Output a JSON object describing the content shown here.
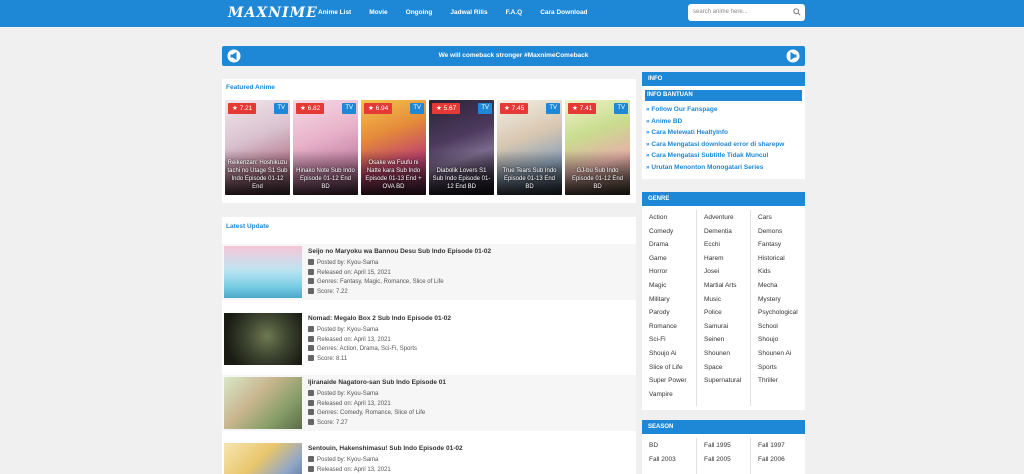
{
  "header": {
    "logo": "MAXNIME",
    "nav": [
      "Anime List",
      "Movie",
      "Ongoing",
      "Jadwal Rilis",
      "F.A.Q",
      "Cara Download"
    ],
    "search_placeholder": "search anime here..."
  },
  "banner": {
    "text": "We will comeback stronger #MaxnimeComeback"
  },
  "featured": {
    "title": "Featured Anime",
    "cards": [
      {
        "rating": "7.21",
        "type": "TV",
        "title": "Reikenzan: Hoshikuzu tachi no Utage S1 Sub Indo Episode 01-12 End"
      },
      {
        "rating": "6.82",
        "type": "TV",
        "title": "Hinako Note Sub Indo Episode 01-12 End BD"
      },
      {
        "rating": "6.94",
        "type": "TV",
        "title": "Osake wa Fuufu ni Natte kara Sub Indo Episode 01-13 End + OVA BD"
      },
      {
        "rating": "5.67",
        "type": "TV",
        "title": "Diabolik Lovers S1 Sub Indo Episode 01-12 End BD"
      },
      {
        "rating": "7.45",
        "type": "TV",
        "title": "True Tears Sub Indo Episode 01-13 End BD"
      },
      {
        "rating": "7.41",
        "type": "TV",
        "title": "GJ-bu Sub Indo Episode 01-12 End BD"
      }
    ]
  },
  "latest": {
    "title": "Latest Update",
    "items": [
      {
        "title": "Seijo no Maryoku wa Bannou Desu Sub Indo Episode 01-02",
        "posted": "Posted by: Kyou-Sama",
        "released": "Released on: April 15, 2021",
        "genres": "Genres: Fantasy, Magic, Romance, Slice of Life",
        "score": "Score: 7.22"
      },
      {
        "title": "Nomad: Megalo Box 2 Sub Indo Episode 01-02",
        "posted": "Posted by: Kyou-Sama",
        "released": "Released on: April 13, 2021",
        "genres": "Genres: Action, Drama, Sci-Fi, Sports",
        "score": "Score: 8.11"
      },
      {
        "title": "Ijiranaide Nagatoro-san Sub Indo Episode 01",
        "posted": "Posted by: Kyou-Sama",
        "released": "Released on: April 13, 2021",
        "genres": "Genres: Comedy, Romance, Slice of Life",
        "score": "Score: 7.27"
      },
      {
        "title": "Sentouin, Hakenshimasu! Sub Indo Episode 01-02",
        "posted": "Posted by: Kyou-Sama",
        "released": "Released on: April 13, 2021",
        "genres": "",
        "score": ""
      }
    ]
  },
  "info": {
    "head": "INFO",
    "sub": "INFO BANTUAN",
    "links": [
      "» Follow Our Fanspage",
      "» Anime BD",
      "» Cara Melewati HealtyInfo",
      "» Cara Mengatasi download error di sharepw",
      "» Cara Mengatasi Subtitle Tidak Muncul",
      "» Urutan Menonton Monogatari Series"
    ]
  },
  "genre": {
    "head": "GENRE",
    "col1": [
      "Action",
      "Comedy",
      "Drama",
      "Game",
      "Horror",
      "Magic",
      "Military",
      "Parody",
      "Romance",
      "Sci-Fi",
      "Shoujo Ai",
      "Slice of Life",
      "Super Power",
      "Vampire"
    ],
    "col2": [
      "Adventure",
      "Dementia",
      "Ecchi",
      "Harem",
      "Josei",
      "Martial Arts",
      "Music",
      "Police",
      "Samurai",
      "Seinen",
      "Shounen",
      "Space",
      "Supernatural"
    ],
    "col3": [
      "Cars",
      "Demons",
      "Fantasy",
      "Historical",
      "Kids",
      "Mecha",
      "Mystery",
      "Psychological",
      "School",
      "Shoujo",
      "Shounen Ai",
      "Sports",
      "Thriller"
    ]
  },
  "season": {
    "head": "SEASON",
    "col1": [
      "BD",
      "Fall 2003"
    ],
    "col2": [
      "Fall 1995",
      "Fall 2005"
    ],
    "col3": [
      "Fall 1997",
      "Fall 2006"
    ]
  },
  "colors": {
    "accent": "#1e88d6",
    "rating": "#e53935"
  }
}
